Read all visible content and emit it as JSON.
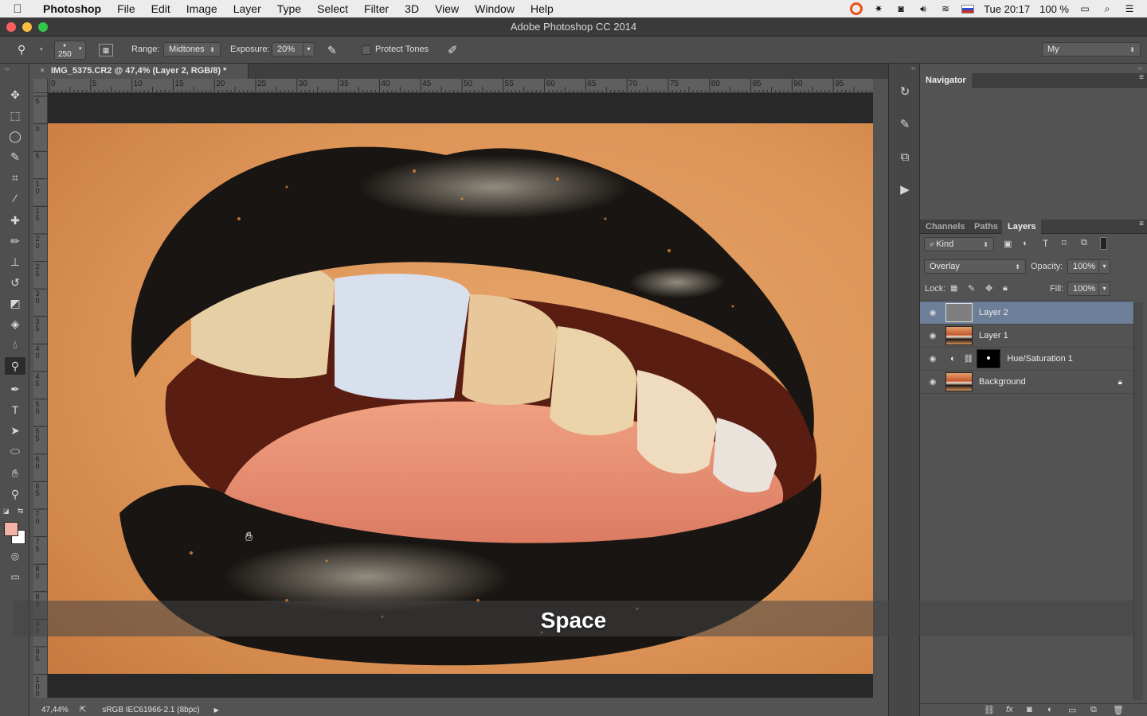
{
  "menubar": {
    "app": "Photoshop",
    "items": [
      "File",
      "Edit",
      "Image",
      "Layer",
      "Type",
      "Select",
      "Filter",
      "3D",
      "View",
      "Window",
      "Help"
    ],
    "clock": "Tue 20:17",
    "battery": "100 %"
  },
  "window": {
    "title": "Adobe Photoshop CC 2014"
  },
  "options": {
    "brush_size": "250",
    "range_label": "Range:",
    "range_value": "Midtones",
    "exposure_label": "Exposure:",
    "exposure_value": "20%",
    "protect_tones": "Protect Tones",
    "workspace": "My"
  },
  "document": {
    "tab_title": "IMG_5375.CR2 @ 47,4% (Layer 2, RGB/8) *",
    "close": "×",
    "zoom": "47,44%",
    "profile": "sRGB IEC61966-2.1 (8bpc)"
  },
  "rulers": {
    "h": [
      "0",
      "5",
      "10",
      "15",
      "20",
      "25",
      "30",
      "35",
      "40",
      "45",
      "50",
      "55",
      "60",
      "65",
      "70",
      "75",
      "80",
      "85",
      "90",
      "95"
    ],
    "v": [
      "5",
      "0",
      "5",
      "1 0",
      "1 5",
      "2 0",
      "2 5",
      "3 0",
      "3 5",
      "4 0",
      "4 5",
      "5 0",
      "5 5",
      "6 0",
      "6 5",
      "7 0",
      "7 5",
      "8 0",
      "8 5",
      "9 0",
      "9 5",
      "1 0 0"
    ]
  },
  "navigator": {
    "title": "Navigator"
  },
  "layers_panel": {
    "tabs": [
      "Channels",
      "Paths",
      "Layers"
    ],
    "active_tab": "Layers",
    "filter": "Kind",
    "blend_mode": "Overlay",
    "opacity_label": "Opacity:",
    "opacity_value": "100%",
    "lock_label": "Lock:",
    "fill_label": "Fill:",
    "fill_value": "100%",
    "layers": [
      {
        "name": "Layer 2",
        "selected": true
      },
      {
        "name": "Layer 1",
        "selected": false
      },
      {
        "name": "Hue/Saturation 1",
        "selected": false
      },
      {
        "name": "Background",
        "selected": false
      }
    ]
  },
  "overlay": {
    "caption": "Space"
  },
  "colors": {
    "accent_selection": "#6d7e98",
    "foreground_swatch": "#f2b3a6",
    "background_swatch": "#ffffff"
  }
}
